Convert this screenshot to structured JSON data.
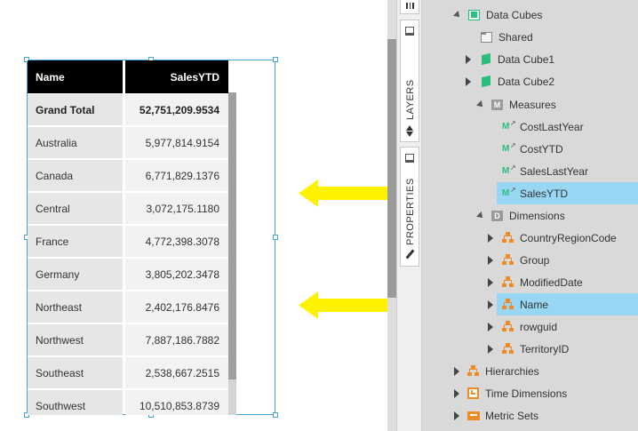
{
  "table": {
    "headers": {
      "name": "Name",
      "value": "SalesYTD"
    },
    "grand_total": {
      "name": "Grand Total",
      "value": "52,751,209.9534"
    },
    "rows": [
      {
        "name": "Australia",
        "value": "5,977,814.9154"
      },
      {
        "name": "Canada",
        "value": "6,771,829.1376"
      },
      {
        "name": "Central",
        "value": "3,072,175.1180"
      },
      {
        "name": "France",
        "value": "4,772,398.3078"
      },
      {
        "name": "Germany",
        "value": "3,805,202.3478"
      },
      {
        "name": "Northeast",
        "value": "2,402,176.8476"
      },
      {
        "name": "Northwest",
        "value": "7,887,186.7882"
      },
      {
        "name": "Southeast",
        "value": "2,538,667.2515"
      },
      {
        "name": "Southwest",
        "value": "10,510,853.8739"
      }
    ]
  },
  "side_tabs": {
    "layers": "LAYERS",
    "properties": "PROPERTIES"
  },
  "tree": {
    "data_cubes": "Data Cubes",
    "shared": "Shared",
    "data_cube1": "Data Cube1",
    "data_cube2": "Data Cube2",
    "measures": "Measures",
    "measure_items": [
      "CostLastYear",
      "CostYTD",
      "SalesLastYear",
      "SalesYTD"
    ],
    "dimensions": "Dimensions",
    "dimension_items": [
      "CountryRegionCode",
      "Group",
      "ModifiedDate",
      "Name",
      "rowguid",
      "TerritoryID"
    ],
    "hierarchies": "Hierarchies",
    "time_dimensions": "Time Dimensions",
    "metric_sets": "Metric Sets"
  },
  "colors": {
    "selection_highlight": "#97d7f3",
    "arrow": "#fff200",
    "header_bg": "#000000",
    "cube_icon": "#2bbd7e",
    "dimension_icon": "#f08a24"
  }
}
